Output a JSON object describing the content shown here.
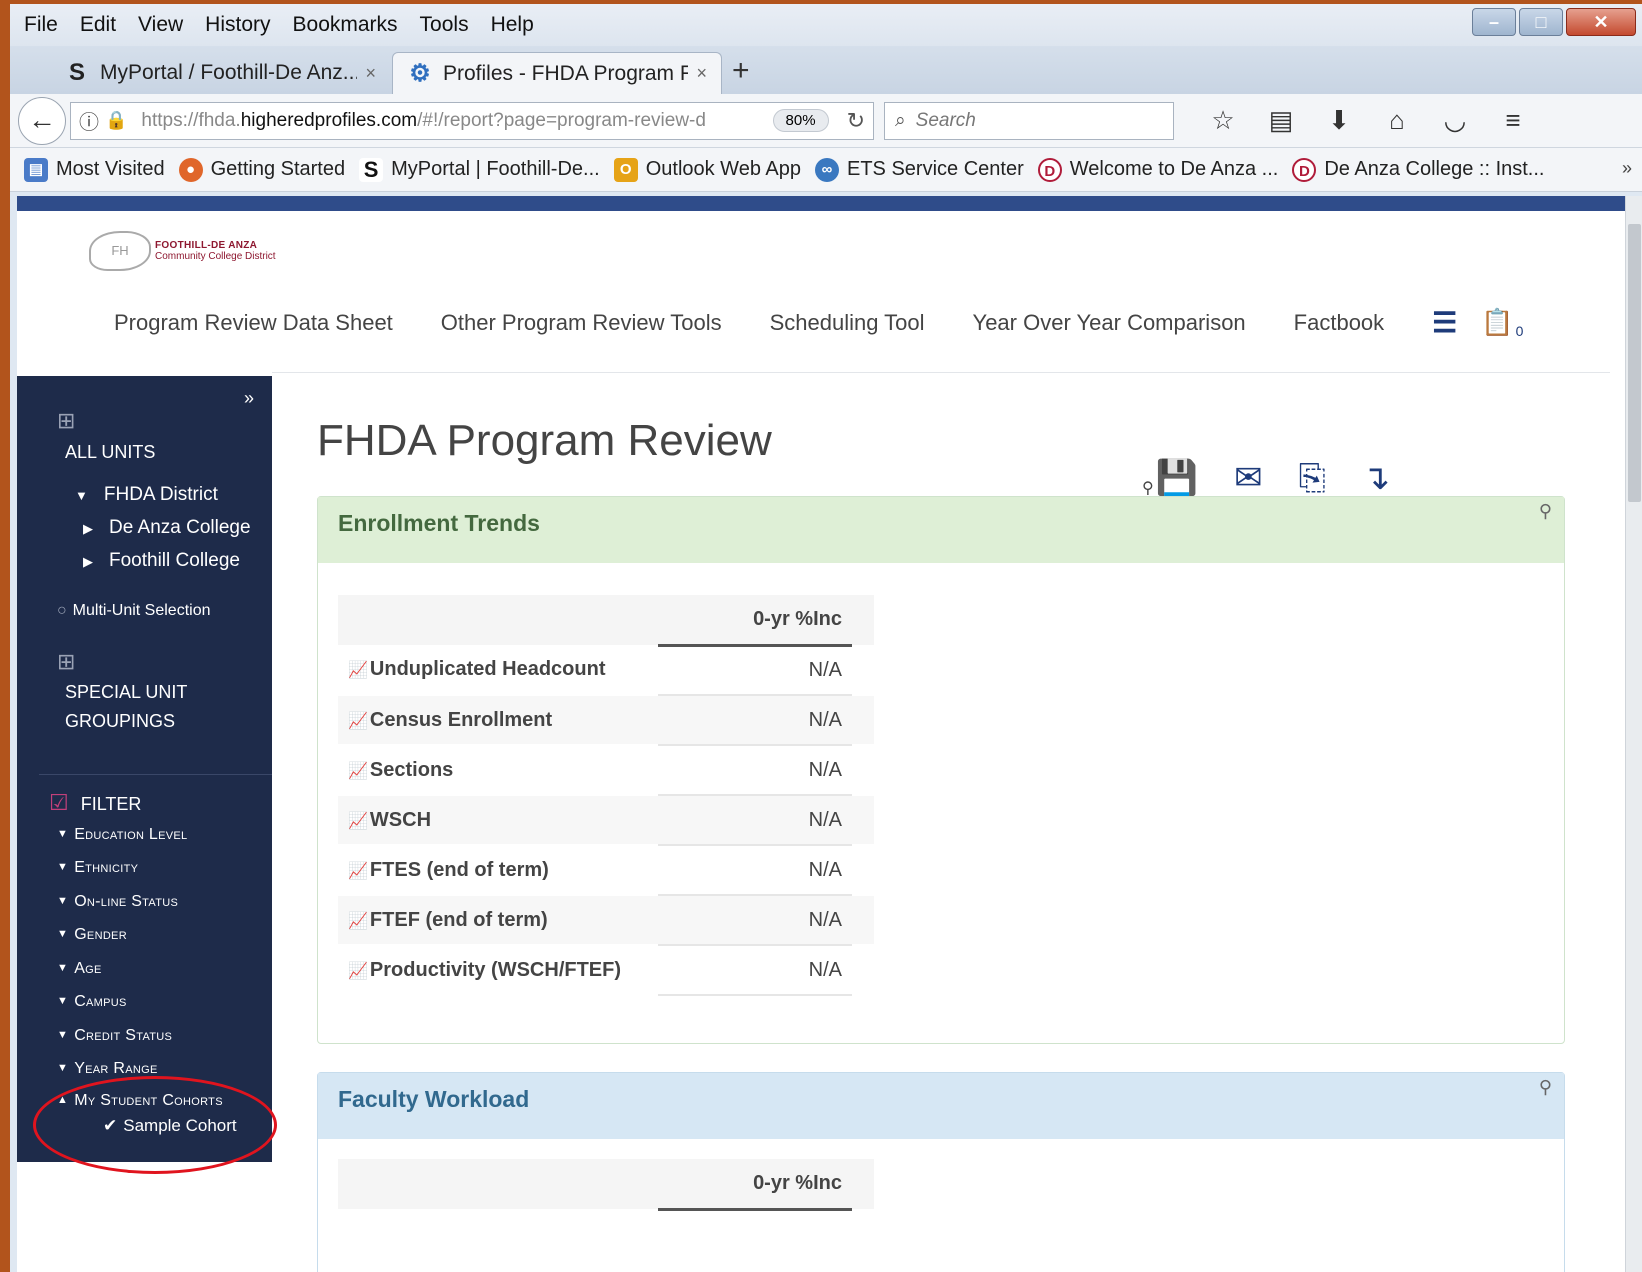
{
  "menu": [
    "File",
    "Edit",
    "View",
    "History",
    "Bookmarks",
    "Tools",
    "Help"
  ],
  "tabs": [
    {
      "icon": "S",
      "title": "MyPortal / Foothill-De Anz...",
      "close": "×"
    },
    {
      "icon": "⚙",
      "title": "Profiles - FHDA Program R...",
      "close": "×"
    }
  ],
  "new_tab": "+",
  "address": {
    "prefix": "https://fhda.",
    "domain": "higheredprofiles.com",
    "path": "/#!/report?page=program-review-d",
    "zoom": "80%"
  },
  "search": {
    "placeholder": "Search"
  },
  "bookmarks": [
    {
      "label": "Most Visited",
      "color": "#4a7bc8",
      "icon": "▤"
    },
    {
      "label": "Getting Started",
      "color": "#e0662a",
      "icon": "●"
    },
    {
      "label": "MyPortal | Foothill-De...",
      "color": "#222222",
      "icon": "S"
    },
    {
      "label": "Outlook Web App",
      "color": "#e6a317",
      "icon": "O"
    },
    {
      "label": "ETS Service Center",
      "color": "#3a78c0",
      "icon": "∞"
    },
    {
      "label": "Welcome to De Anza ...",
      "color": "#b01c3a",
      "icon": "D"
    },
    {
      "label": "De Anza College :: Inst...",
      "color": "#b01c3a",
      "icon": "D"
    }
  ],
  "site": {
    "logo_line1": "FOOTHILL-DE ANZA",
    "logo_line2": "Community College District",
    "nav": [
      "Program Review Data Sheet",
      "Other Program Review Tools",
      "Scheduling Tool",
      "Year Over Year Comparison",
      "Factbook"
    ],
    "cart_count": "0"
  },
  "sidebar": {
    "all_units": "ALL UNITS",
    "district": "FHDA District",
    "colleges": [
      "De Anza College",
      "Foothill College"
    ],
    "multi_unit": "Multi-Unit Selection",
    "special_line1": "SPECIAL UNIT",
    "special_line2": "GROUPINGS",
    "filter": "FILTER",
    "filters": [
      "Education Level",
      "Ethnicity",
      "On-line Status",
      "Gender",
      "Age",
      "Campus",
      "Credit Status",
      "Year Range"
    ],
    "cohorts": "My Student Cohorts",
    "cohort_item": "Sample Cohort"
  },
  "main": {
    "title": "FHDA Program Review",
    "panel1": {
      "title": "Enrollment Trends",
      "column": "0-yr %Inc",
      "rows": [
        {
          "label": "Unduplicated Headcount",
          "value": "N/A"
        },
        {
          "label": "Census Enrollment",
          "value": "N/A"
        },
        {
          "label": "Sections",
          "value": "N/A"
        },
        {
          "label": "WSCH",
          "value": "N/A"
        },
        {
          "label": "FTES (end of term)",
          "value": "N/A"
        },
        {
          "label": "FTEF (end of term)",
          "value": "N/A"
        },
        {
          "label": "Productivity (WSCH/FTEF)",
          "value": "N/A"
        }
      ]
    },
    "panel2": {
      "title": "Faculty Workload",
      "column": "0-yr %Inc"
    }
  }
}
